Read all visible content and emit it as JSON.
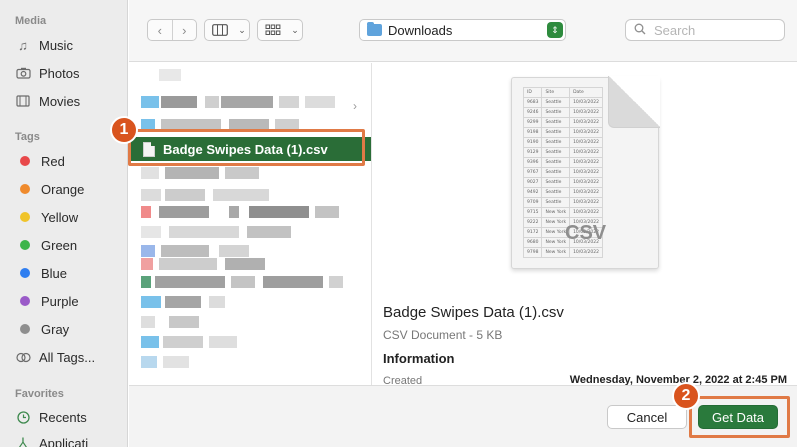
{
  "sidebar": {
    "media_header": "Media",
    "media": [
      {
        "label": "Music",
        "icon": "music-note-icon"
      },
      {
        "label": "Photos",
        "icon": "camera-icon"
      },
      {
        "label": "Movies",
        "icon": "film-icon"
      }
    ],
    "tags_header": "Tags",
    "tags": [
      {
        "label": "Red",
        "color": "#e8484a"
      },
      {
        "label": "Orange",
        "color": "#ef8a2c"
      },
      {
        "label": "Yellow",
        "color": "#f0c42a"
      },
      {
        "label": "Green",
        "color": "#3cb54a"
      },
      {
        "label": "Blue",
        "color": "#2f7ef0"
      },
      {
        "label": "Purple",
        "color": "#9a5ac8"
      },
      {
        "label": "Gray",
        "color": "#8e8e8e"
      }
    ],
    "all_tags": "All Tags...",
    "favorites_header": "Favorites",
    "favorites": [
      {
        "label": "Recents",
        "icon": "clock-icon"
      },
      {
        "label": "Applicati",
        "icon": "applications-icon"
      }
    ]
  },
  "toolbar": {
    "location": "Downloads",
    "search_placeholder": "Search"
  },
  "file_list": {
    "selected_file": "Badge Swipes Data (1).csv"
  },
  "preview": {
    "file_name": "Badge Swipes Data (1).csv",
    "kind_size": "CSV Document - 5 KB",
    "info_header": "Information",
    "created_label": "Created",
    "created_value": "Wednesday, November 2, 2022 at 2:45 PM",
    "thumbnail_badge": "CSV",
    "thumbnail_table": {
      "headers": [
        "ID",
        "Site",
        "Date"
      ],
      "rows": [
        [
          "9683",
          "Seattle",
          "10/03/2022"
        ],
        [
          "9246",
          "Seattle",
          "10/03/2022"
        ],
        [
          "9299",
          "Seattle",
          "10/03/2022"
        ],
        [
          "9198",
          "Seattle",
          "10/03/2022"
        ],
        [
          "9190",
          "Seattle",
          "10/03/2022"
        ],
        [
          "9129",
          "Seattle",
          "10/03/2022"
        ],
        [
          "9396",
          "Seattle",
          "10/03/2022"
        ],
        [
          "9767",
          "Seattle",
          "10/03/2022"
        ],
        [
          "9027",
          "Seattle",
          "10/03/2022"
        ],
        [
          "9492",
          "Seattle",
          "10/03/2022"
        ],
        [
          "9709",
          "Seattle",
          "10/03/2022"
        ],
        [
          "9715",
          "New York",
          "10/03/2022"
        ],
        [
          "9222",
          "New York",
          "10/03/2022"
        ],
        [
          "9172",
          "New York",
          "10/03/2022"
        ],
        [
          "9680",
          "New York",
          "10/03/2022"
        ],
        [
          "9798",
          "New York",
          "10/03/2022"
        ]
      ]
    }
  },
  "footer": {
    "cancel_label": "Cancel",
    "get_data_label": "Get Data"
  },
  "annotations": {
    "step1": "1",
    "step2": "2"
  }
}
